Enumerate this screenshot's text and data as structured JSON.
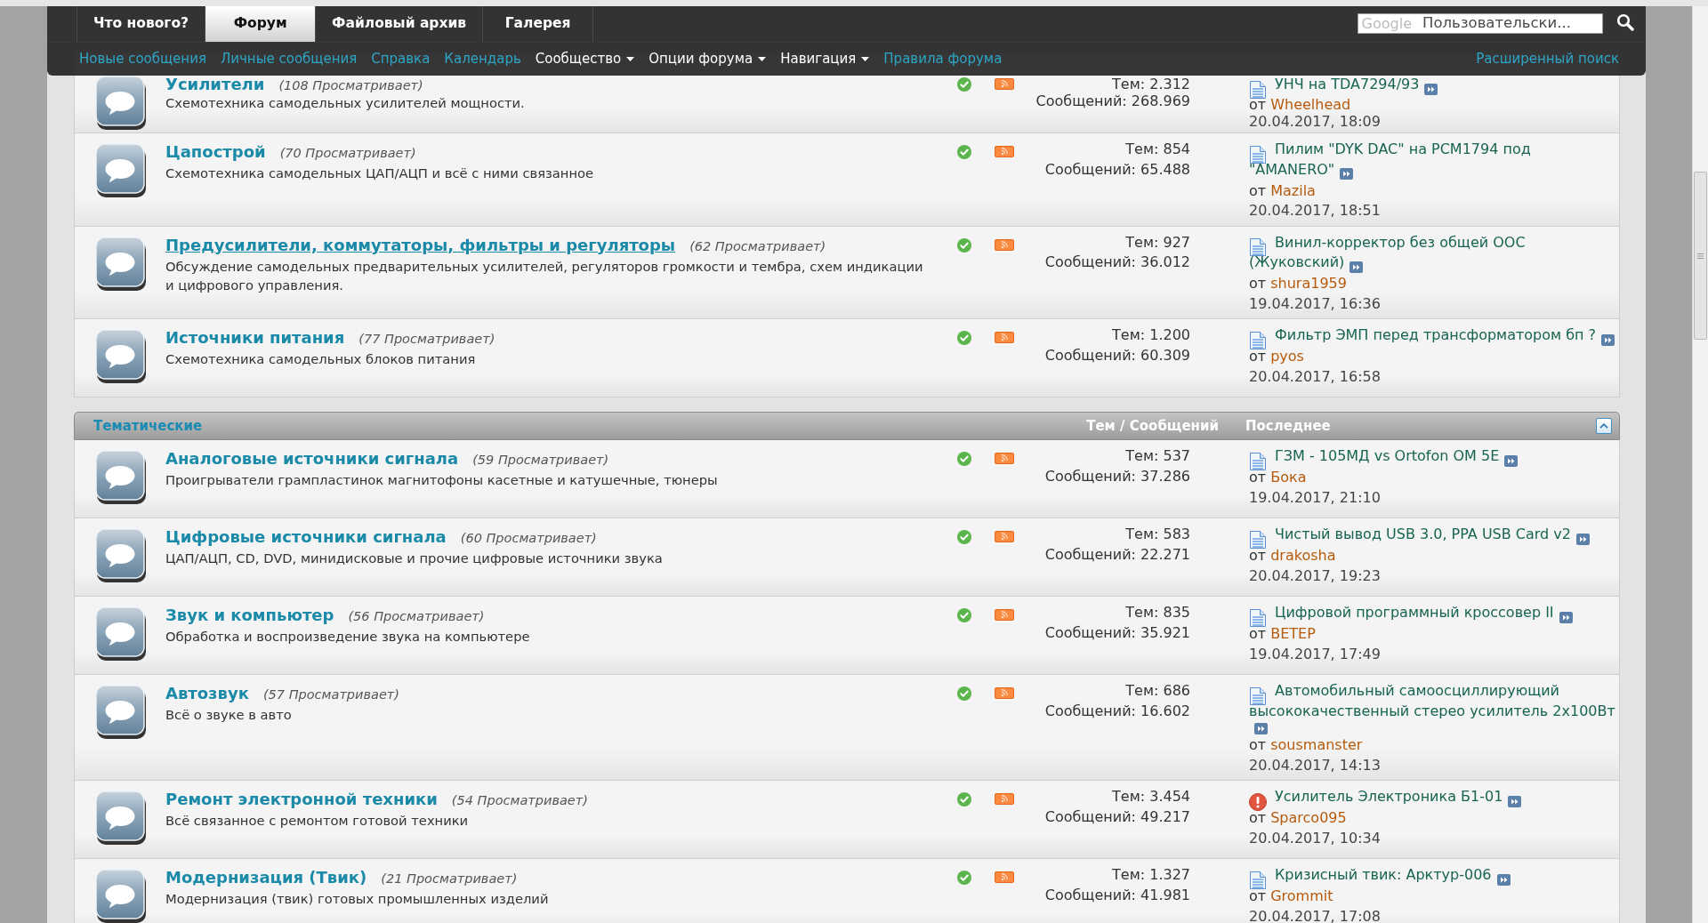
{
  "header": {
    "tabs": [
      {
        "label": "Что нового?",
        "selected": false
      },
      {
        "label": "Форум",
        "selected": true
      },
      {
        "label": "Файловый архив",
        "selected": false
      },
      {
        "label": "Галерея",
        "selected": false
      }
    ],
    "search": {
      "logo": "Google",
      "placeholder": "Пользовательски..."
    },
    "links": [
      {
        "label": "Новые сообщения",
        "kind": "link"
      },
      {
        "label": "Личные сообщения",
        "kind": "link"
      },
      {
        "label": "Справка",
        "kind": "link"
      },
      {
        "label": "Календарь",
        "kind": "link"
      },
      {
        "label": "Сообщество",
        "kind": "menu"
      },
      {
        "label": "Опции форума",
        "kind": "menu"
      },
      {
        "label": "Навигация",
        "kind": "menu"
      },
      {
        "label": "Правила форума",
        "kind": "link"
      }
    ],
    "advanced_search": "Расширенный поиск"
  },
  "sections": [
    {
      "forums": [
        {
          "title": "Усилители",
          "hovered": false,
          "viewers": "(108 Просматривает)",
          "description": "Схемотехника самодельных усилителей мощности.",
          "topics": "Тем: 2.312",
          "messages": "Сообщений: 268.969",
          "last_post": {
            "kind": "document",
            "title": "УНЧ на TDA7294/93",
            "by": "от",
            "user": "Wheelhead",
            "date": "20.04.2017, 18:09"
          }
        },
        {
          "title": "Цапострой",
          "hovered": false,
          "viewers": "(70 Просматривает)",
          "description": "Схемотехника самодельных ЦАП/АЦП и всё с ними связанное",
          "topics": "Тем: 854",
          "messages": "Сообщений: 65.488",
          "last_post": {
            "kind": "document",
            "title": "Пилим \"DYK DAC\" на PCM1794 под \"AMANERO\"",
            "by": "от",
            "user": "Mazila",
            "date": "20.04.2017, 18:51"
          }
        },
        {
          "title": "Предусилители, коммутаторы, фильтры и регуляторы",
          "hovered": true,
          "viewers": "(62 Просматривает)",
          "description": "Обсуждение самодельных предварительных усилителей, регуляторов громкости и тембра, схем индикации и цифрового управления.",
          "topics": "Тем: 927",
          "messages": "Сообщений: 36.012",
          "last_post": {
            "kind": "document",
            "title": "Винил-корректор без общей ООС (Жуковский)",
            "by": "от",
            "user": "shura1959",
            "date": "19.04.2017, 16:36"
          }
        },
        {
          "title": "Источники питания",
          "hovered": false,
          "viewers": "(77 Просматривает)",
          "description": "Схемотехника самодельных блоков питания",
          "topics": "Тем: 1.200",
          "messages": "Сообщений: 60.309",
          "last_post": {
            "kind": "document",
            "title": "Фильтр ЭМП перед трансформатором бп ?",
            "by": "от",
            "user": "pyos",
            "date": "20.04.2017, 16:58"
          }
        }
      ]
    },
    {
      "title": "Тематические",
      "columns": [
        "Тем / Сообщений",
        "Последнее"
      ],
      "expanded": true,
      "forums": [
        {
          "title": "Аналоговые источники сигнала",
          "hovered": false,
          "viewers": "(59 Просматривает)",
          "description": "Проигрыватели грампластинок магнитофоны касетные и катушечные, тюнеры",
          "topics": "Тем: 537",
          "messages": "Сообщений: 37.286",
          "last_post": {
            "kind": "document",
            "title": "ГЗМ - 105МД vs Ortofon OM 5E",
            "by": "от",
            "user": "Бока",
            "date": "19.04.2017, 21:10"
          }
        },
        {
          "title": "Цифровые источники сигнала",
          "hovered": false,
          "viewers": "(60 Просматривает)",
          "description": "ЦАП/АЦП, CD, DVD, минидисковые и прочие цифровые источники звука",
          "topics": "Тем: 583",
          "messages": "Сообщений: 22.271",
          "last_post": {
            "kind": "document",
            "title": "Чистый вывод USB 3.0, PPA USB Card v2",
            "by": "от",
            "user": "drakosha",
            "date": "20.04.2017, 19:23"
          }
        },
        {
          "title": "Звук и компьютер",
          "hovered": false,
          "viewers": "(56 Просматривает)",
          "description": "Обработка и воспроизведение звука на компьютере",
          "topics": "Тем: 835",
          "messages": "Сообщений: 35.921",
          "last_post": {
            "kind": "document",
            "title": "Цифровой программный кроссовер II",
            "by": "от",
            "user": "ВЕТЕР",
            "date": "19.04.2017, 17:49"
          }
        },
        {
          "title": "Автозвук",
          "hovered": false,
          "viewers": "(57 Просматривает)",
          "description": "Всё о звуке в авто",
          "topics": "Тем: 686",
          "messages": "Сообщений: 16.602",
          "last_post": {
            "kind": "document",
            "title": "Автомобильный самоосциллирующий высококачественный стерео усилитель 2x100Вт",
            "by": "от",
            "user": "sousmanster",
            "date": "20.04.2017, 14:13"
          }
        },
        {
          "title": "Ремонт электронной техники",
          "hovered": false,
          "viewers": "(54 Просматривает)",
          "description": "Всё связанное с ремонтом готовой техники",
          "topics": "Тем: 3.454",
          "messages": "Сообщений: 49.217",
          "last_post": {
            "kind": "alert",
            "title": "Усилитель Электроника Б1-01",
            "by": "от",
            "user": "Sparco095",
            "date": "20.04.2017, 10:34"
          }
        },
        {
          "title": "Модернизация (Твик)",
          "hovered": false,
          "viewers": "(21 Просматривает)",
          "description": "Модернизация (твик) готовых промышленных изделий",
          "topics": "Тем: 1.327",
          "messages": "Сообщений: 41.981",
          "last_post": {
            "kind": "document",
            "title": "Кризисный твик: Арктур-006",
            "by": "от",
            "user": "Grommit",
            "date": "20.04.2017, 17:08"
          }
        }
      ]
    }
  ]
}
